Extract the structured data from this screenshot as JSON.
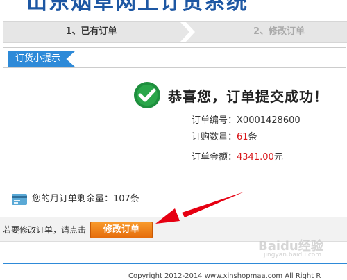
{
  "header": {
    "title": "山东烟草网上订货系统"
  },
  "steps": [
    {
      "label": "1、已有订单"
    },
    {
      "label": "2、修改订单"
    }
  ],
  "tip": {
    "tab_label": "订货小提示"
  },
  "result": {
    "title": "恭喜您，订单提交成功！",
    "order_no_label": "订单编号：",
    "order_no": "X0001428600",
    "quantity_label": "订购数量：",
    "quantity": "61",
    "quantity_unit": "条",
    "amount_label": "订单金额：",
    "amount": "4341.00",
    "amount_unit": "元"
  },
  "quota": {
    "text": "您的月订单剩余量：107条"
  },
  "modify": {
    "hint": "若要修改订单，请点击",
    "button": "修改订单"
  },
  "footer": {
    "copyright": "Copyright 2012-2014 www.xinshopmaa.com All Right R"
  },
  "colors": {
    "accent": "#2e8ad8",
    "button": "#f0821a",
    "annotation": "#e60012",
    "success": "#1e8f3e"
  },
  "watermark": {
    "text": "Baidu经验",
    "sub": "jingyan.baidu.com"
  }
}
